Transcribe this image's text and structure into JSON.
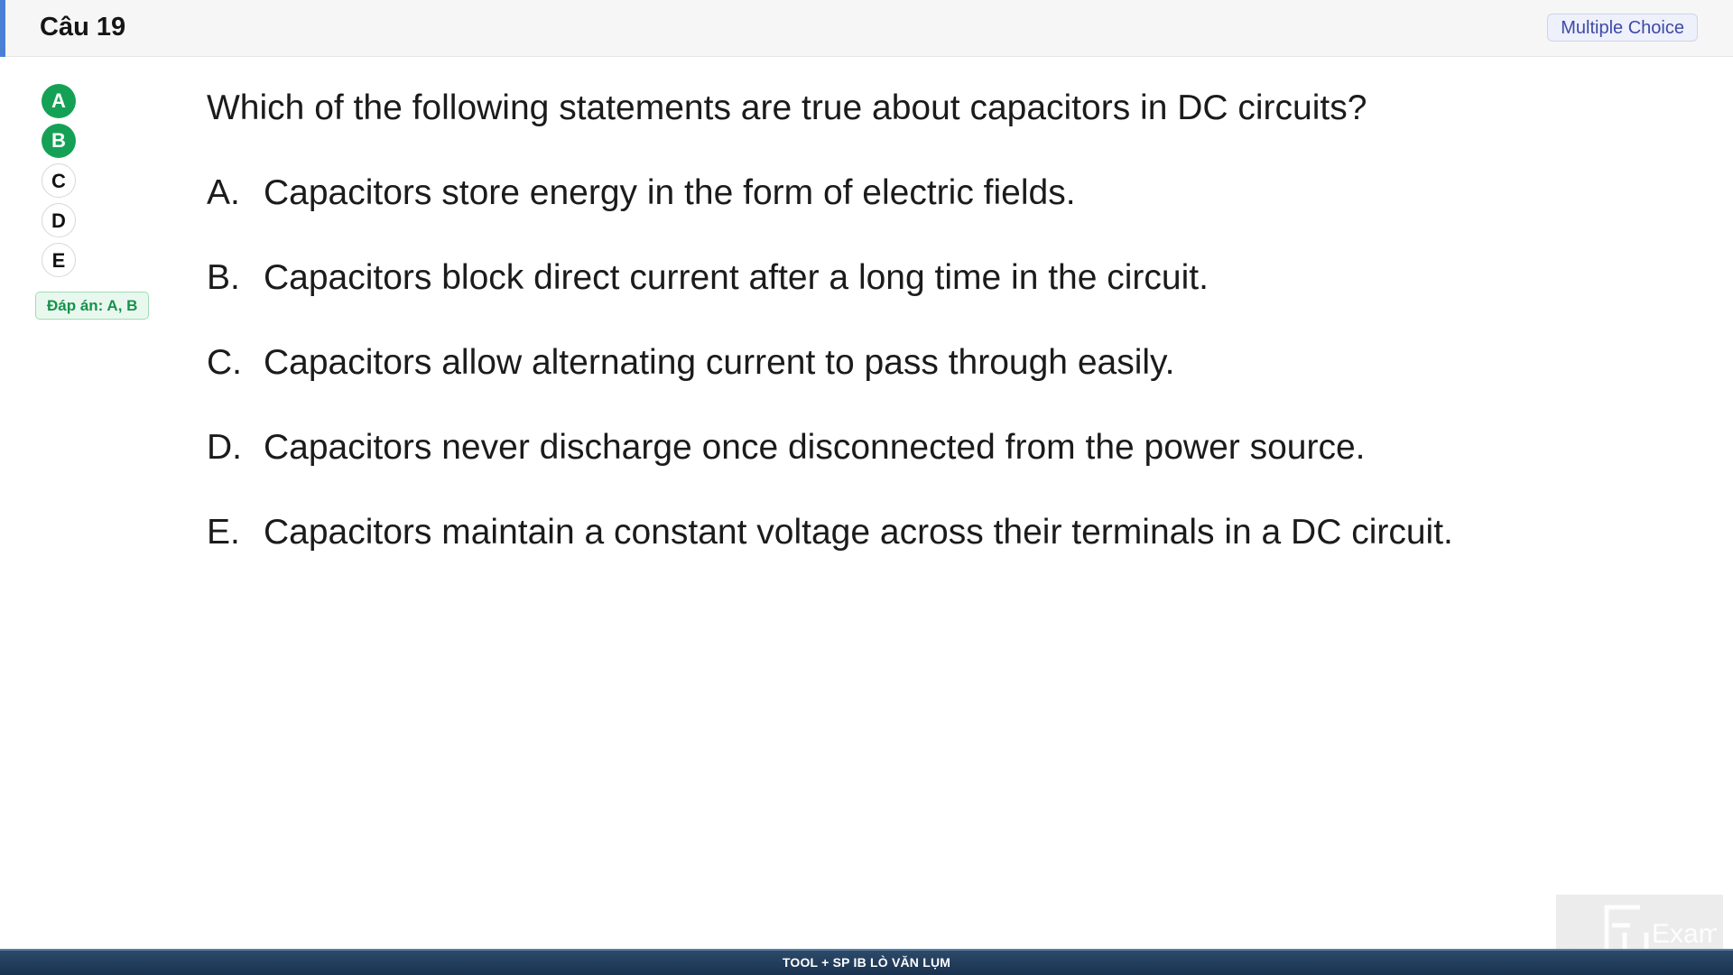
{
  "header": {
    "question_number": "Câu 19",
    "type_badge": "Multiple Choice"
  },
  "answer_panel": {
    "options": [
      {
        "label": "A",
        "selected": true
      },
      {
        "label": "B",
        "selected": true
      },
      {
        "label": "C",
        "selected": false
      },
      {
        "label": "D",
        "selected": false
      },
      {
        "label": "E",
        "selected": false
      }
    ],
    "answer_key": "Đáp án: A, B"
  },
  "question": {
    "text": "Which of the following statements are true about capacitors in DC circuits?",
    "options": [
      {
        "letter": "A.",
        "text": "Capacitors store energy in the form of electric fields."
      },
      {
        "letter": "B.",
        "text": "Capacitors block direct current after a long time in the circuit."
      },
      {
        "letter": "C.",
        "text": "Capacitors allow alternating current to pass through easily."
      },
      {
        "letter": "D.",
        "text": "Capacitors never discharge once disconnected from the power source."
      },
      {
        "letter": "E.",
        "text": "Capacitors maintain a constant voltage across their terminals in a DC circuit."
      }
    ]
  },
  "watermark": {
    "logo_text": "Exam"
  },
  "footer": {
    "text": "TOOL + SP IB LÒ VĂN LỤM"
  },
  "colors": {
    "header_accent": "#4a7fd6",
    "selected_answer": "#14a155",
    "badge_text": "#3c4aa8",
    "footer_bg": "#19324f"
  }
}
